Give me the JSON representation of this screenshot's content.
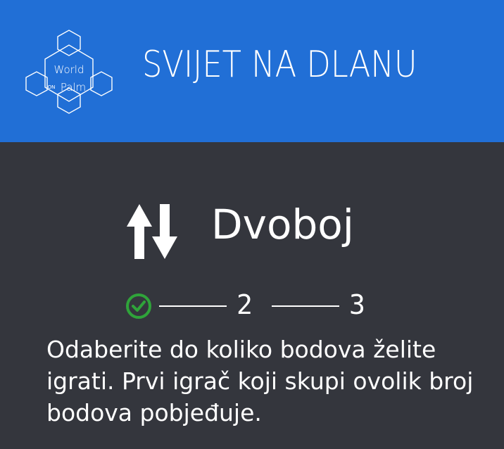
{
  "header": {
    "logo_text_top": "World",
    "logo_text_on": "ON",
    "logo_text_bottom": "Palm",
    "app_title": "SVIJET NA DLANU",
    "background_color": "#216fd6"
  },
  "main": {
    "mode_icon": "swap-arrows-icon",
    "mode_title": "Dvoboj",
    "stepper": {
      "completed_icon": "check-circle-icon",
      "completed_color": "#2fa33a",
      "step_2": "2",
      "step_3": "3"
    },
    "instructions": "Odaberite do koliko bodova želite igrati. Prvi igrač koji skupi ovolik broj bodova pobjeđuje.",
    "background_color": "#34363d"
  }
}
